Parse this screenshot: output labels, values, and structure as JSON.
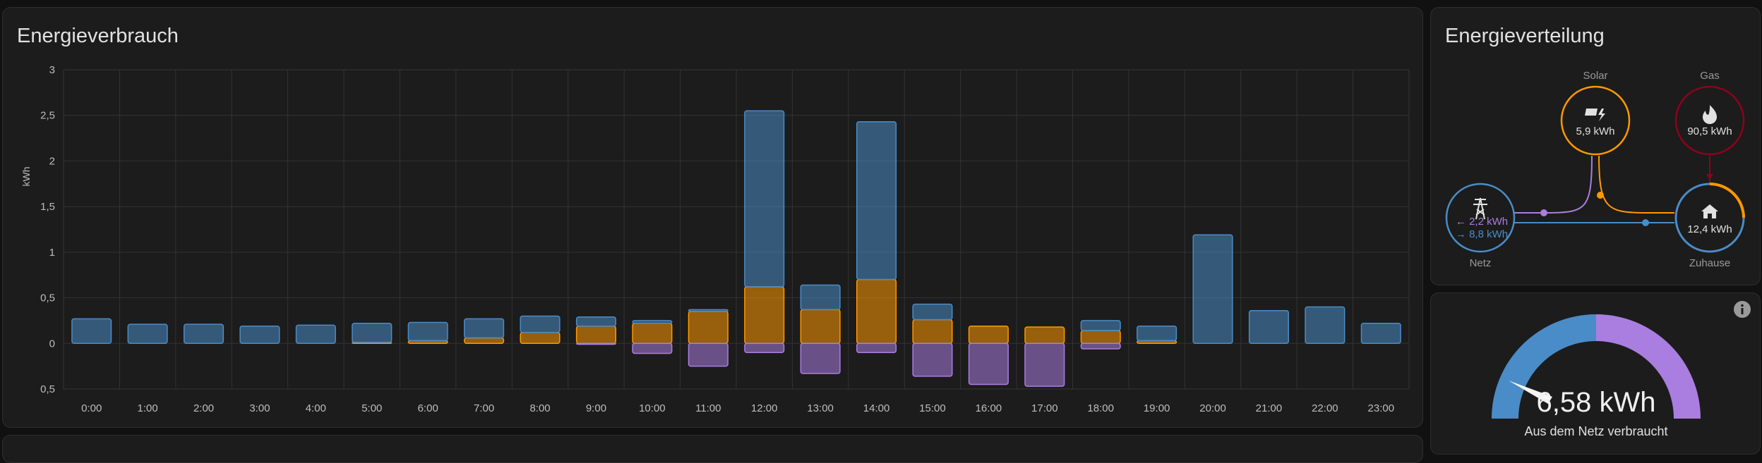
{
  "usage_card": {
    "title": "Energieverbrauch"
  },
  "distribution_card": {
    "title": "Energieverteilung",
    "solar": {
      "label": "Solar",
      "value": "5,9 kWh",
      "icon": "solar-panel-icon"
    },
    "gas": {
      "label": "Gas",
      "value": "90,5 kWh",
      "icon": "flame-icon"
    },
    "grid": {
      "label": "Netz",
      "return_value": "← 2,2 kWh",
      "consume_value": "→ 8,8 kWh",
      "icon": "transmission-tower-icon"
    },
    "home": {
      "label": "Zuhause",
      "value": "12,4 kWh",
      "icon": "home-icon"
    }
  },
  "gauge_card": {
    "value": "6,58 kWh",
    "label": "Aus dem Netz verbraucht",
    "fraction_from_grid": 0.5
  },
  "colors": {
    "grid_consumption": "#4a8cc7",
    "solar": "#ff9800",
    "grid_return": "#a97ee0",
    "gas": "#8e021b",
    "card_bg": "#1c1c1c"
  },
  "chart_data": {
    "type": "bar",
    "stacked": true,
    "ylabel": "kWh",
    "ylim": [
      -0.5,
      3
    ],
    "yticks": [
      "3",
      "2,5",
      "2",
      "1,5",
      "1",
      "0,5",
      "0",
      "0,5"
    ],
    "ytick_values": [
      3,
      2.5,
      2,
      1.5,
      1,
      0.5,
      0,
      -0.5
    ],
    "grid": true,
    "categories": [
      "0:00",
      "1:00",
      "2:00",
      "3:00",
      "4:00",
      "5:00",
      "6:00",
      "7:00",
      "8:00",
      "9:00",
      "10:00",
      "11:00",
      "12:00",
      "13:00",
      "14:00",
      "15:00",
      "16:00",
      "17:00",
      "18:00",
      "19:00",
      "20:00",
      "21:00",
      "22:00",
      "23:00"
    ],
    "series": [
      {
        "key": "solar",
        "values": [
          0,
          0,
          0,
          0,
          0,
          0.01,
          0.03,
          0.06,
          0.12,
          0.19,
          0.22,
          0.35,
          0.62,
          0.37,
          0.7,
          0.26,
          0.19,
          0.18,
          0.14,
          0.03,
          0,
          0,
          0,
          0
        ]
      },
      {
        "key": "grid_consumption",
        "values": [
          0.27,
          0.21,
          0.21,
          0.19,
          0.2,
          0.21,
          0.2,
          0.21,
          0.18,
          0.1,
          0.03,
          0.02,
          1.93,
          0.27,
          1.73,
          0.17,
          0,
          0,
          0.11,
          0.16,
          1.19,
          0.36,
          0.4,
          0.22
        ]
      },
      {
        "key": "grid_return",
        "values": [
          0,
          0,
          0,
          0,
          0,
          0,
          0,
          0,
          0,
          -0.01,
          -0.11,
          -0.25,
          -0.1,
          -0.33,
          -0.1,
          -0.36,
          -0.45,
          -0.47,
          -0.06,
          0,
          0,
          0,
          0,
          0
        ]
      }
    ]
  }
}
